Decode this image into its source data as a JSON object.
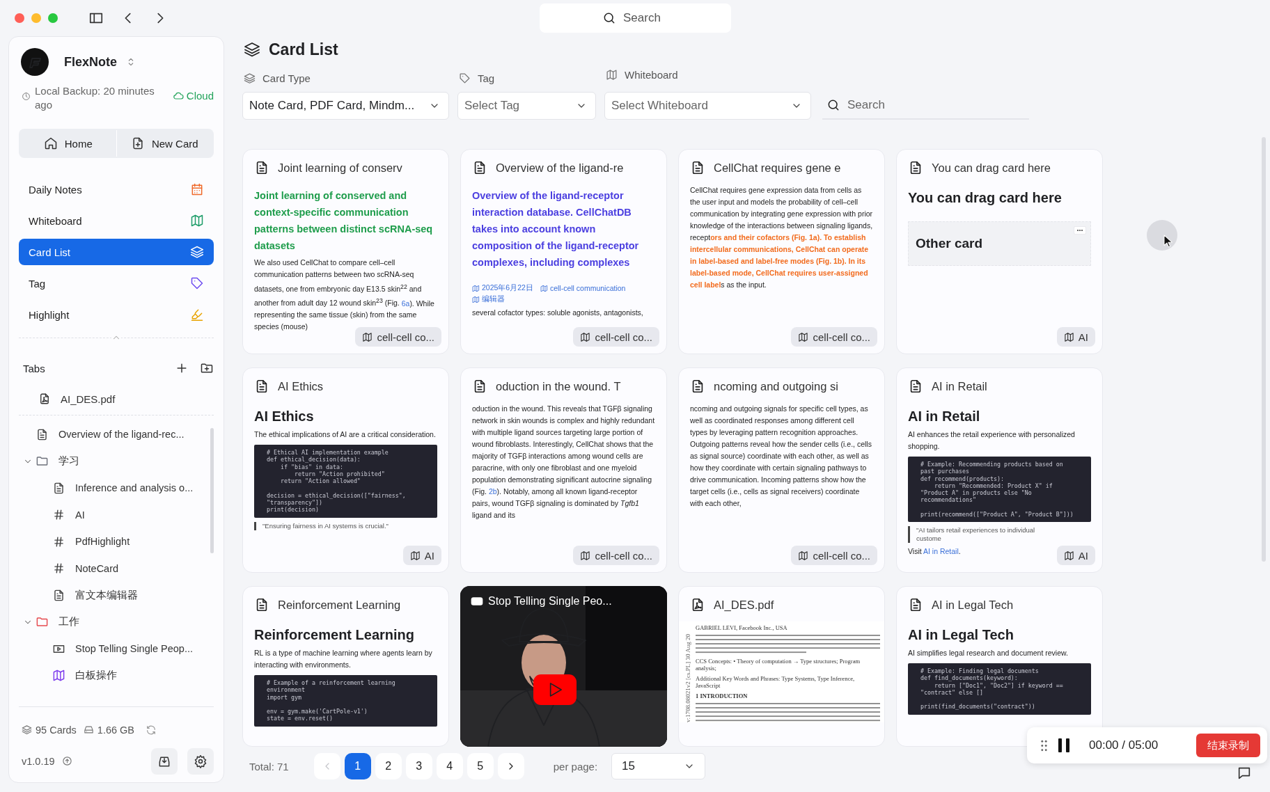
{
  "top_search": {
    "placeholder": "Search"
  },
  "sidebar": {
    "app_name": "FlexNote",
    "backup": "Local Backup: 20 minutes ago",
    "cloud": "Cloud",
    "quick_buttons": [
      {
        "label": "Home"
      },
      {
        "label": "New Card"
      }
    ],
    "nav": [
      {
        "label": "Daily Notes",
        "selected": false
      },
      {
        "label": "Whiteboard",
        "selected": false
      },
      {
        "label": "Card List",
        "selected": true
      },
      {
        "label": "Tag",
        "selected": false
      },
      {
        "label": "Highlight",
        "selected": false
      }
    ],
    "tabs_title": "Tabs",
    "open_tabs": [
      {
        "label": "AI_DES.pdf",
        "kind": "pdf"
      }
    ],
    "tree": [
      {
        "label": "Overview of the ligand-rec...",
        "kind": "document"
      },
      {
        "label": "学习",
        "kind": "folder",
        "color": "#6b6f7a",
        "expanded": true,
        "children": [
          {
            "label": "Inference and analysis o...",
            "kind": "document"
          },
          {
            "label": "AI",
            "kind": "tag"
          },
          {
            "label": "PdfHighlight",
            "kind": "tag"
          },
          {
            "label": "NoteCard",
            "kind": "tag"
          },
          {
            "label": "富文本编辑器",
            "kind": "document"
          }
        ]
      },
      {
        "label": "工作",
        "kind": "folder",
        "color": "#e5484d",
        "expanded": true,
        "children": [
          {
            "label": "Stop Telling Single Peop...",
            "kind": "video"
          },
          {
            "label": "白板操作",
            "kind": "whiteboard"
          }
        ]
      }
    ],
    "footer": {
      "cards": "95 Cards",
      "storage": "1.66 GB",
      "version": "v1.0.19"
    }
  },
  "page": {
    "title": "Card List",
    "filters": [
      {
        "label": "Card Type",
        "value": "Note Card, PDF Card, Mindm..."
      },
      {
        "label": "Tag",
        "placeholder": "Select Tag"
      },
      {
        "label": "Whiteboard",
        "placeholder": "Select Whiteboard"
      }
    ],
    "search": {
      "placeholder": "Search"
    }
  },
  "cards": [
    {
      "kind": "note",
      "title": "Joint learning of conserv",
      "tag": "cell-cell co...",
      "blocks": [
        {
          "kind": "lead",
          "color": "#1f9d4c",
          "text": "Joint learning of conserved and context-specific communication patterns between distinct scRNA-seq datasets"
        },
        {
          "kind": "paragraph",
          "segments": [
            {
              "kind": "plain",
              "text": "We also used CellChat to compare cell–cell communication patterns between two scRNA-seq datasets, one from embryonic day E13.5 skin$^{22}$ and another from adult day 12 wound skin$^{23}$ (Fig. "
            },
            {
              "kind": "link",
              "text": "6a"
            },
            {
              "kind": "plain",
              "text": "). While representing the same tissue (skin) from the same species (mouse)"
            }
          ]
        }
      ]
    },
    {
      "kind": "note",
      "title": "Overview of the ligand-re",
      "tag": "cell-cell co...",
      "blocks": [
        {
          "kind": "lead",
          "color": "#4b3fe0",
          "text": "Overview of the ligand-receptor interaction database. CellChatDB takes into account known composition of the ligand-receptor complexes, including complexes"
        },
        {
          "kind": "meta",
          "items": [
            "2025年6月22日",
            "cell-cell communication",
            "编辑器"
          ]
        },
        {
          "kind": "paragraph",
          "segments": [
            {
              "kind": "plain",
              "text": "several cofactor types: soluble agonists, antagonists,"
            }
          ]
        }
      ]
    },
    {
      "kind": "note",
      "title": "CellChat requires gene e",
      "tag": "cell-cell co...",
      "blocks": [
        {
          "kind": "paragraph",
          "segments": [
            {
              "kind": "plain",
              "text": "CellChat requires gene expression data from cells as the user input and models the probability of cell–cell communication by integrating gene expression with prior knowledge of the interactions between signaling ligands, recept"
            },
            {
              "kind": "accent",
              "text": "ors and their cofactors (Fig. 1a). To establish intercellular communications, CellChat can operate in label-based and label-free modes (Fig. 1b). In its label-based mode, CellChat requires user-assigned cell label"
            },
            {
              "kind": "plain",
              "text": "s as the input."
            }
          ]
        }
      ]
    },
    {
      "kind": "note",
      "title": "You can drag card here",
      "tag": "AI",
      "blocks": [
        {
          "kind": "heading",
          "text": "You can drag card here"
        },
        {
          "kind": "embed",
          "text": "Other card"
        }
      ]
    },
    {
      "kind": "note",
      "title": "AI Ethics",
      "tag": "AI",
      "blocks": [
        {
          "kind": "heading",
          "text": "AI Ethics"
        },
        {
          "kind": "paragraph",
          "segments": [
            {
              "kind": "plain",
              "text": "The ethical implications of AI are a critical consideration."
            }
          ]
        },
        {
          "kind": "code",
          "text": "# Ethical AI implementation example\ndef ethical_decision(data):\n    if \"bias\" in data:\n        return \"Action prohibited\"\n    return \"Action allowed\"\n\ndecision = ethical_decision([\"fairness\",\n\"transparency\"])\nprint(decision)"
        },
        {
          "kind": "quote",
          "text": "\"Ensuring fairness in AI systems is crucial.\""
        }
      ]
    },
    {
      "kind": "note",
      "title": "oduction in the wound. T",
      "tag": "cell-cell co...",
      "blocks": [
        {
          "kind": "paragraph",
          "segments": [
            {
              "kind": "plain",
              "text": "oduction in the wound. This reveals that TGFβ signaling network in skin wounds is complex and highly redundant with multiple ligand sources targeting large portion of wound fibroblasts. Interestingly, CellChat shows that the majority of TGFβ interactions among wound cells are paracrine, with only one fibroblast and one myeloid population demonstrating significant autocrine signaling (Fig. "
            },
            {
              "kind": "link",
              "text": "2b"
            },
            {
              "kind": "plain",
              "text": "). Notably, among all known ligand-receptor pairs, wound TGFβ signaling is dominated by *Tgfb1* ligand and its"
            }
          ]
        }
      ]
    },
    {
      "kind": "note",
      "title": "ncoming and outgoing si",
      "tag": "cell-cell co...",
      "blocks": [
        {
          "kind": "paragraph",
          "segments": [
            {
              "kind": "plain",
              "text": "ncoming and outgoing signals for specific cell types, as well as coordinated responses among different cell types by leveraging pattern recognition approaches. Outgoing patterns reveal how the sender cells (i.e., cells as signal source) coordinate with each other, as well as how they coordinate with certain signaling pathways to drive communication. Incoming patterns show how the target cells (i.e., cells as signal receivers) coordinate with each other,"
            }
          ]
        }
      ]
    },
    {
      "kind": "note",
      "title": "AI in Retail",
      "tag": "AI",
      "blocks": [
        {
          "kind": "heading",
          "text": "AI in Retail"
        },
        {
          "kind": "paragraph",
          "segments": [
            {
              "kind": "plain",
              "text": "AI enhances the retail experience with personalized shopping."
            }
          ]
        },
        {
          "kind": "code",
          "text": "# Example: Recommending products based on\npast purchases\ndef recommend(products):\n    return \"Recommended: Product X\" if\n\"Product A\" in products else \"No\nrecommendations\"\n\nprint(recommend([\"Product A\", \"Product B\"]))"
        },
        {
          "kind": "quote",
          "text": "\"AI tailors retail experiences to individual custome"
        },
        {
          "kind": "paragraph",
          "segments": [
            {
              "kind": "plain",
              "text": "Visit "
            },
            {
              "kind": "link",
              "text": "AI in Retail"
            },
            {
              "kind": "plain",
              "text": "."
            }
          ]
        }
      ]
    },
    {
      "kind": "note",
      "title": "Reinforcement Learning",
      "blocks": [
        {
          "kind": "heading",
          "text": "Reinforcement Learning"
        },
        {
          "kind": "paragraph",
          "segments": [
            {
              "kind": "plain",
              "text": "RL is a type of machine learning where agents learn by interacting with environments."
            }
          ]
        },
        {
          "kind": "code",
          "text": "# Example of a reinforcement learning\nenvironment\nimport gym\n\nenv = gym.make('CartPole-v1')\nstate = env.reset()"
        }
      ]
    },
    {
      "kind": "video",
      "title": "Stop Telling Single Peo..."
    },
    {
      "kind": "pdf",
      "title": "AI_DES.pdf",
      "blocks": [
        {
          "kind": "pdf_page",
          "side": "v:1708.08021v2 [cs.PL] 30 Aug 20",
          "lines": [
            "GABRIEL LEVI, Facebook Inc., USA",
            "CCS Concepts: • Theory of computation → Type structures; Program analysis;",
            "Additional Key Words and Phrases: Type Systems, Type Inference, JavaScript",
            "1 INTRODUCTION"
          ]
        }
      ]
    },
    {
      "kind": "note",
      "title": "AI in Legal Tech",
      "blocks": [
        {
          "kind": "heading",
          "text": "AI in Legal Tech"
        },
        {
          "kind": "paragraph",
          "segments": [
            {
              "kind": "plain",
              "text": "AI simplifies legal research and document review."
            }
          ]
        },
        {
          "kind": "code",
          "text": "# Example: Finding legal documents\ndef find_documents(keyword):\n    return [\"Doc1\", \"Doc2\"] if keyword ==\n\"contract\" else []\n\nprint(find_documents(\"contract\"))"
        }
      ]
    }
  ],
  "pagination": {
    "total": "Total: 71",
    "pages": [
      {
        "label": "1",
        "selected": true
      },
      {
        "label": "2",
        "selected": false
      },
      {
        "label": "3",
        "selected": false
      },
      {
        "label": "4",
        "selected": false
      },
      {
        "label": "5",
        "selected": false
      }
    ],
    "per_page_label": "per page:",
    "per_page": "15"
  },
  "recorder": {
    "time": "00:00 / 05:00",
    "stop": "结束录制"
  }
}
